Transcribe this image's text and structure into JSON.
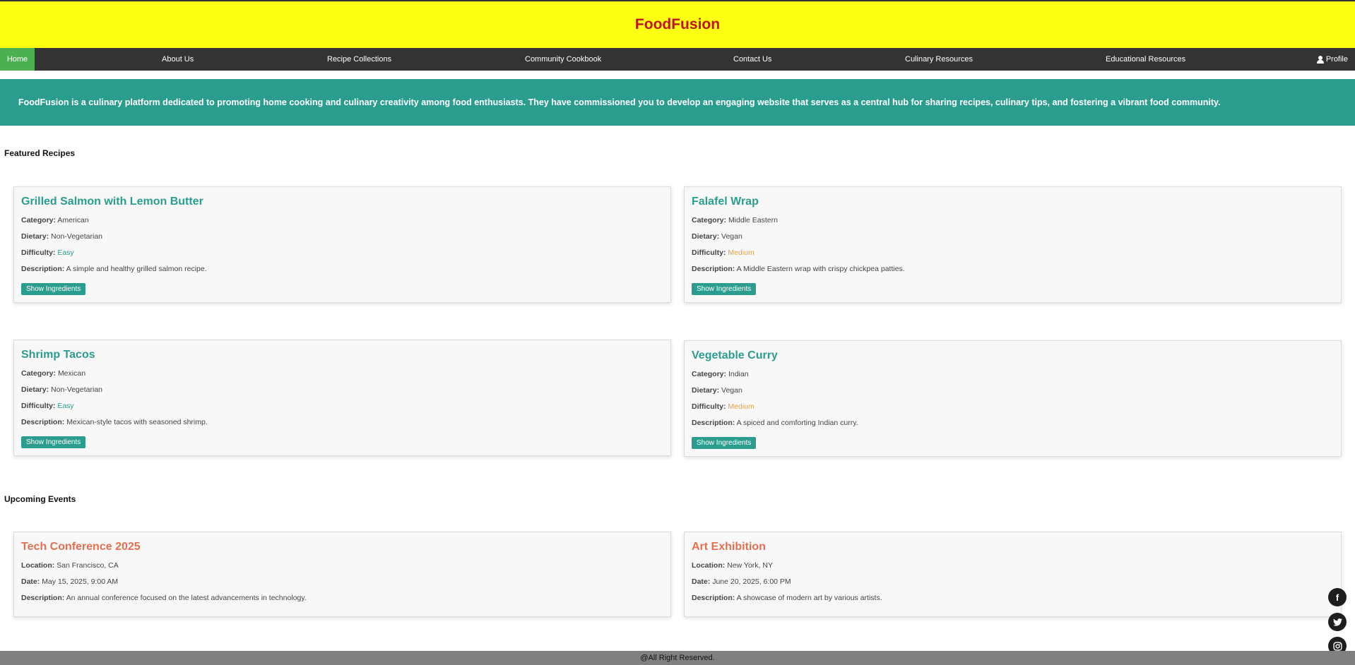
{
  "header": {
    "title": "FoodFusion"
  },
  "nav": {
    "home": "Home",
    "about": "About Us",
    "recipes": "Recipe Collections",
    "community": "Community Cookbook",
    "contact": "Contact Us",
    "culinary": "Culinary Resources",
    "educational": "Educational Resources",
    "profile": "Profile"
  },
  "intro": {
    "text": "FoodFusion is a culinary platform dedicated to promoting home cooking and culinary creativity among food enthusiasts. They have commissioned you to develop an engaging website that serves as a central hub for sharing recipes, culinary tips, and fostering a vibrant food community."
  },
  "labels": {
    "category": "Category:",
    "dietary": "Dietary:",
    "difficulty": "Difficulty:",
    "description": "Description:",
    "location": "Location:",
    "date": "Date:",
    "show_ingredients": "Show Ingredients"
  },
  "featured": {
    "title": "Featured Recipes",
    "recipes": [
      {
        "name": "Grilled Salmon with Lemon Butter",
        "category": "American",
        "dietary": "Non-Vegetarian",
        "difficulty": "Easy",
        "description": "A simple and healthy grilled salmon recipe."
      },
      {
        "name": "Falafel Wrap",
        "category": "Middle Eastern",
        "dietary": "Vegan",
        "difficulty": "Medium",
        "description": "A Middle Eastern wrap with crispy chickpea patties."
      },
      {
        "name": "Shrimp Tacos",
        "category": "Mexican",
        "dietary": "Non-Vegetarian",
        "difficulty": "Easy",
        "description": "Mexican-style tacos with seasoned shrimp."
      },
      {
        "name": "Vegetable Curry",
        "category": "Indian",
        "dietary": "Vegan",
        "difficulty": "Medium",
        "description": "A spiced and comforting Indian curry."
      }
    ]
  },
  "events": {
    "title": "Upcoming Events",
    "items": [
      {
        "name": "Tech Conference 2025",
        "location": "San Francisco, CA",
        "date": "May 15, 2025, 9:00 AM",
        "description": "An annual conference focused on the latest advancements in technology."
      },
      {
        "name": "Art Exhibition",
        "location": "New York, NY",
        "date": "June 20, 2025, 6:00 PM",
        "description": "A showcase of modern art by various artists."
      }
    ]
  },
  "footer": {
    "text": "@All Right Reserved."
  },
  "social": {
    "facebook": "f",
    "twitter": "t",
    "instagram": "◎"
  },
  "colors": {
    "header_bg": "#ffff14",
    "brand_red": "#c0141d",
    "nav_bg": "#333333",
    "nav_active": "#4caf50",
    "teal": "#2a9d8f",
    "event_orange": "#e76f51",
    "medium_orange": "#e9a23b",
    "footer_bg": "#808080"
  }
}
